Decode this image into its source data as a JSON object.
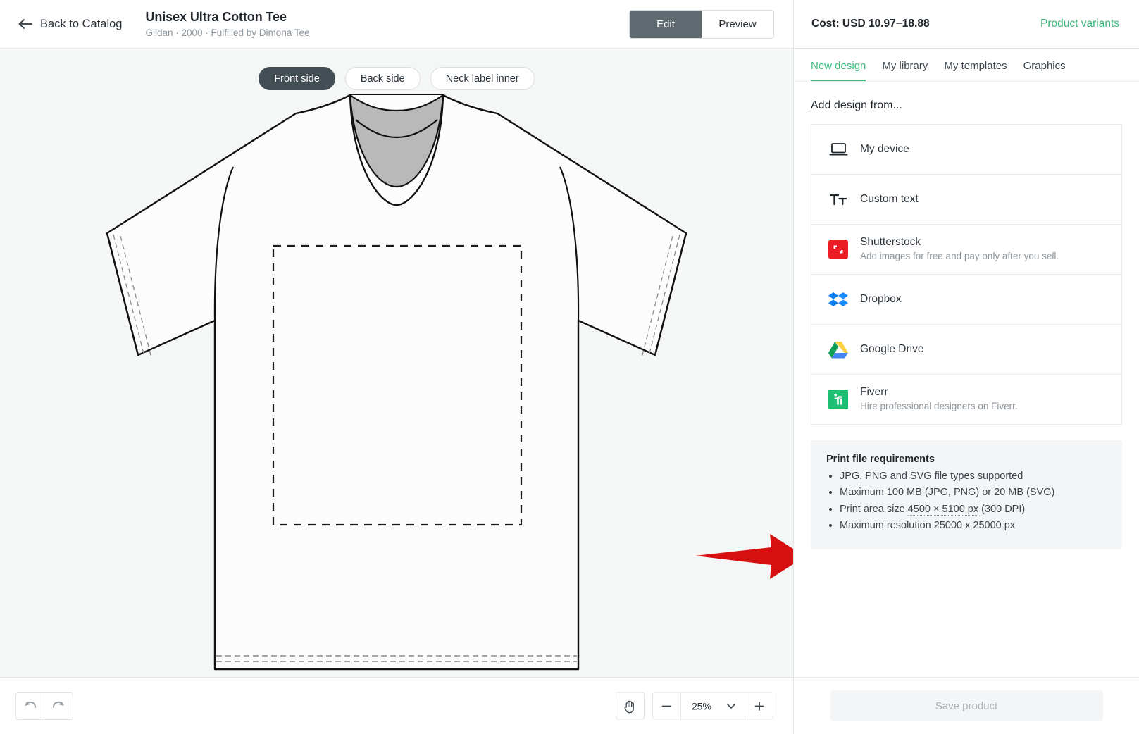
{
  "header": {
    "back_label": "Back to Catalog",
    "back_icon": "arrow-left-icon",
    "product_title": "Unisex Ultra Cotton Tee",
    "product_subtitle": "Gildan · 2000 · Fulfilled by Dimona Tee",
    "mode_tabs": [
      {
        "label": "Edit",
        "active": true
      },
      {
        "label": "Preview",
        "active": false
      }
    ],
    "cost": "Cost: USD 10.97−18.88",
    "variants_link": "Product variants"
  },
  "canvas": {
    "side_tabs": [
      {
        "label": "Front side",
        "active": true
      },
      {
        "label": "Back side",
        "active": false
      },
      {
        "label": "Neck label inner",
        "active": false
      }
    ],
    "annotation": {
      "icon": "red-arrow-icon",
      "color": "#d61010",
      "points_to": "print-file-requirements"
    }
  },
  "bottom_toolbar": {
    "undo_icon": "undo-icon",
    "redo_icon": "redo-icon",
    "pan_icon": "hand-pan-icon",
    "zoom_out_icon": "minus-icon",
    "zoom_in_icon": "plus-icon",
    "zoom_dropdown_icon": "chevron-down-icon",
    "zoom_level": "25%"
  },
  "panel": {
    "tabs": [
      {
        "label": "New design",
        "active": true
      },
      {
        "label": "My library",
        "active": false
      },
      {
        "label": "My templates",
        "active": false
      },
      {
        "label": "Graphics",
        "active": false
      }
    ],
    "heading": "Add design from...",
    "sources": [
      {
        "label": "My device",
        "desc": "",
        "icon": "laptop-icon"
      },
      {
        "label": "Custom text",
        "desc": "",
        "icon": "text-format-icon"
      },
      {
        "label": "Shutterstock",
        "desc": "Add images for free and pay only after you sell.",
        "icon": "shutterstock-icon"
      },
      {
        "label": "Dropbox",
        "desc": "",
        "icon": "dropbox-icon"
      },
      {
        "label": "Google Drive",
        "desc": "",
        "icon": "google-drive-icon"
      },
      {
        "label": "Fiverr",
        "desc": "Hire professional designers on Fiverr.",
        "icon": "fiverr-icon"
      }
    ],
    "requirements": {
      "title": "Print file requirements",
      "items": [
        "JPG, PNG and SVG file types supported",
        "Maximum 100 MB (JPG, PNG) or 20 MB (SVG)",
        "Maximum resolution 25000 x 25000 px"
      ],
      "print_area_prefix": "Print area size ",
      "print_area_value": "4500 × 5100 px",
      "print_area_suffix": " (300 DPI)"
    },
    "save_label": "Save product"
  },
  "colors": {
    "accent_green": "#3ab87a",
    "active_dark": "#434d54",
    "canvas_bg": "#f5f6f6",
    "annotation_red": "#d61010"
  }
}
